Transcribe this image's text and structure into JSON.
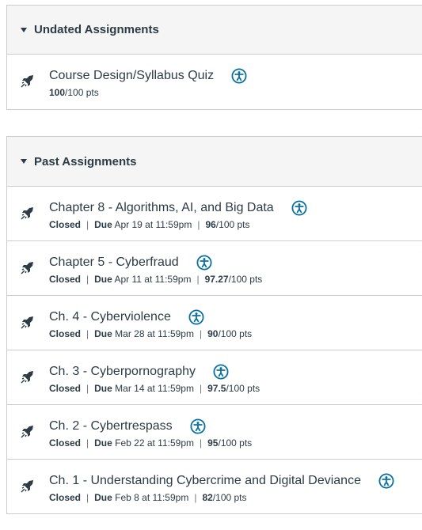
{
  "groups": [
    {
      "title": "Undated Assignments",
      "items": [
        {
          "title": "Course Design/Syllabus Quiz",
          "status": "",
          "due_label": "",
          "due": "",
          "score": "100",
          "points": "/100 pts"
        }
      ]
    },
    {
      "title": "Past Assignments",
      "items": [
        {
          "title": "Chapter 8 - Algorithms, AI, and Big Data",
          "status": "Closed",
          "due_label": "Due",
          "due": " Apr 19 at 11:59pm",
          "score": "96",
          "points": "/100 pts"
        },
        {
          "title": "Chapter 5 - Cyberfraud",
          "status": "Closed",
          "due_label": "Due",
          "due": " Apr 11 at 11:59pm",
          "score": "97.27",
          "points": "/100 pts"
        },
        {
          "title": "Ch. 4 - Cyberviolence",
          "status": "Closed",
          "due_label": "Due",
          "due": " Mar 28 at 11:59pm",
          "score": "90",
          "points": "/100 pts"
        },
        {
          "title": "Ch. 3 - Cyberpornography",
          "status": "Closed",
          "due_label": "Due",
          "due": " Mar 14 at 11:59pm",
          "score": "97.5",
          "points": "/100 pts"
        },
        {
          "title": "Ch. 2 - Cybertrespass",
          "status": "Closed",
          "due_label": "Due",
          "due": " Feb 22 at 11:59pm",
          "score": "95",
          "points": "/100 pts"
        },
        {
          "title": "Ch. 1 - Understanding Cybercrime and Digital Deviance",
          "status": "Closed",
          "due_label": "Due",
          "due": " Feb 8 at 11:59pm",
          "score": "82",
          "points": "/100 pts"
        }
      ]
    }
  ],
  "icons": {
    "item": "rocket-icon",
    "accessibility": "accessibility-icon",
    "collapse": "caret-down-icon"
  },
  "colors": {
    "text": "#2d3b45",
    "border": "#c7cdd1",
    "header_bg": "#f5f5f5",
    "accessibility": "#0770a3"
  }
}
